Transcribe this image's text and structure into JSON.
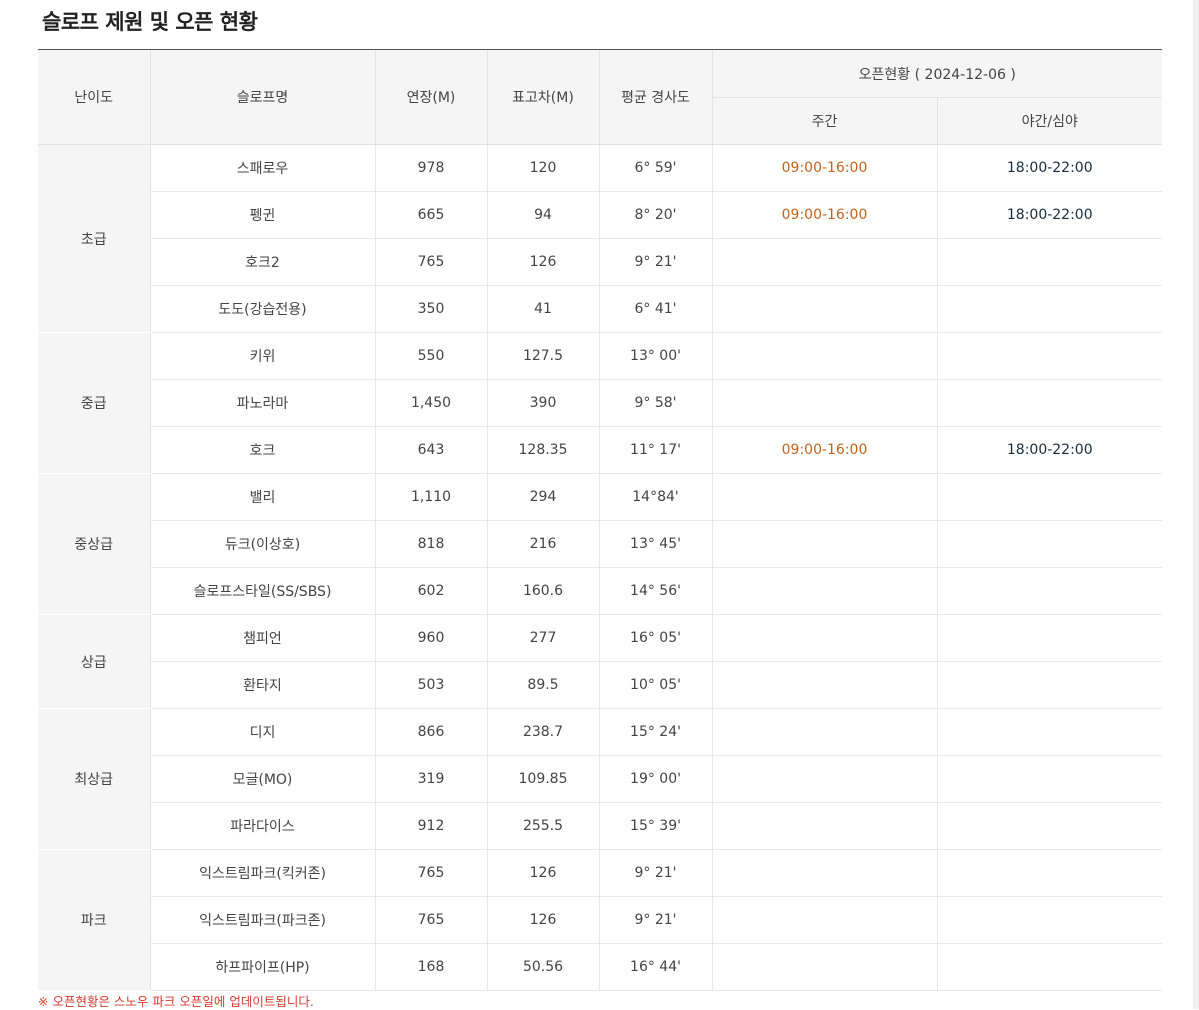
{
  "title": "슬로프 제원 및 오픈 현황",
  "headers": {
    "level": "난이도",
    "slope_name": "슬로프명",
    "length": "연장(M)",
    "elevation": "표고차(M)",
    "slope": "평균 경사도",
    "open_status": "오픈현황 ( 2024-12-06 )",
    "day": "주간",
    "night": "야간/심야"
  },
  "groups": [
    {
      "level": "초급",
      "rows": [
        {
          "name": "스패로우",
          "length": "978",
          "elevation": "120",
          "slope": "6° 59'",
          "day": "09:00-16:00",
          "night": "18:00-22:00"
        },
        {
          "name": "펭귄",
          "length": "665",
          "elevation": "94",
          "slope": "8° 20'",
          "day": "09:00-16:00",
          "night": "18:00-22:00"
        },
        {
          "name": "호크2",
          "length": "765",
          "elevation": "126",
          "slope": "9° 21'",
          "day": "",
          "night": ""
        },
        {
          "name": "도도(강습전용)",
          "length": "350",
          "elevation": "41",
          "slope": "6° 41'",
          "day": "",
          "night": ""
        }
      ]
    },
    {
      "level": "중급",
      "rows": [
        {
          "name": "키위",
          "length": "550",
          "elevation": "127.5",
          "slope": "13° 00'",
          "day": "",
          "night": ""
        },
        {
          "name": "파노라마",
          "length": "1,450",
          "elevation": "390",
          "slope": "9° 58'",
          "day": "",
          "night": ""
        },
        {
          "name": "호크",
          "length": "643",
          "elevation": "128.35",
          "slope": "11° 17'",
          "day": "09:00-16:00",
          "night": "18:00-22:00"
        }
      ]
    },
    {
      "level": "중상급",
      "rows": [
        {
          "name": "밸리",
          "length": "1,110",
          "elevation": "294",
          "slope": "14°84'",
          "day": "",
          "night": ""
        },
        {
          "name": "듀크(이상호)",
          "length": "818",
          "elevation": "216",
          "slope": "13° 45'",
          "day": "",
          "night": ""
        },
        {
          "name": "슬로프스타일(SS/SBS)",
          "length": "602",
          "elevation": "160.6",
          "slope": "14° 56'",
          "day": "",
          "night": ""
        }
      ]
    },
    {
      "level": "상급",
      "rows": [
        {
          "name": "챔피언",
          "length": "960",
          "elevation": "277",
          "slope": "16° 05'",
          "day": "",
          "night": ""
        },
        {
          "name": "환타지",
          "length": "503",
          "elevation": "89.5",
          "slope": "10° 05'",
          "day": "",
          "night": ""
        }
      ]
    },
    {
      "level": "최상급",
      "rows": [
        {
          "name": "디지",
          "length": "866",
          "elevation": "238.7",
          "slope": "15° 24'",
          "day": "",
          "night": ""
        },
        {
          "name": "모글(MO)",
          "length": "319",
          "elevation": "109.85",
          "slope": "19° 00'",
          "day": "",
          "night": ""
        },
        {
          "name": "파라다이스",
          "length": "912",
          "elevation": "255.5",
          "slope": "15° 39'",
          "day": "",
          "night": ""
        }
      ]
    },
    {
      "level": "파크",
      "rows": [
        {
          "name": "익스트림파크(킥커존)",
          "length": "765",
          "elevation": "126",
          "slope": "9° 21'",
          "day": "",
          "night": ""
        },
        {
          "name": "익스트림파크(파크존)",
          "length": "765",
          "elevation": "126",
          "slope": "9° 21'",
          "day": "",
          "night": ""
        },
        {
          "name": "하프파이프(HP)",
          "length": "168",
          "elevation": "50.56",
          "slope": "16° 44'",
          "day": "",
          "night": ""
        }
      ]
    }
  ],
  "note": "※ 오픈현황은 스노우 파크 오픈일에 업데이트됩니다.",
  "colors": {
    "day_time": "#c0641f",
    "night_time": "#1a2b3c",
    "note": "#d83a2e"
  }
}
